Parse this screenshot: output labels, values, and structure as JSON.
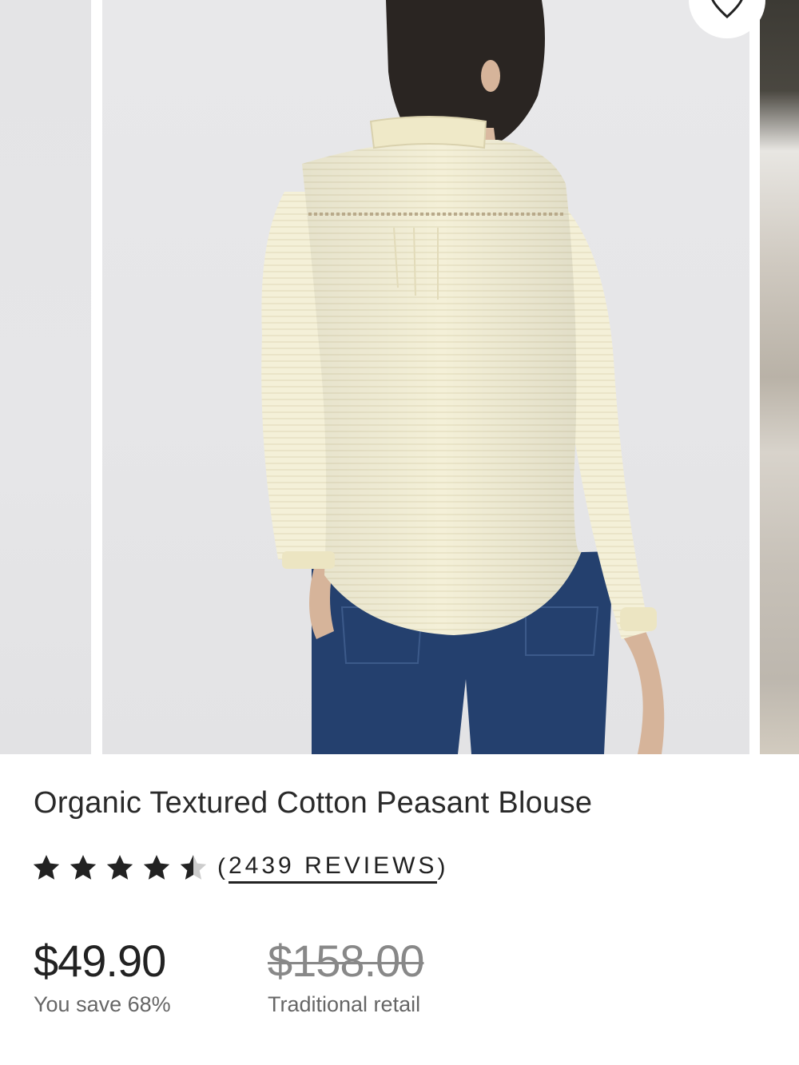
{
  "gallery": {
    "favorite_icon": "heart-outline-icon",
    "main_image_alt": "Back view of model wearing cream organic textured cotton peasant blouse with ruffle collar and blue jeans"
  },
  "product": {
    "title": "Organic Textured Cotton Peasant Blouse",
    "rating": 4.5,
    "rating_max": 5,
    "reviews_open": "(",
    "reviews_label": "2439 REVIEWS",
    "reviews_close": ")",
    "price": "$49.90",
    "savings": "You save 68%",
    "retail_price": "$158.00",
    "retail_label": "Traditional retail"
  },
  "colors": {
    "text": "#222222",
    "muted": "#666666",
    "strike": "#888888",
    "blouse": "#f3efd6",
    "denim": "#24406e"
  }
}
